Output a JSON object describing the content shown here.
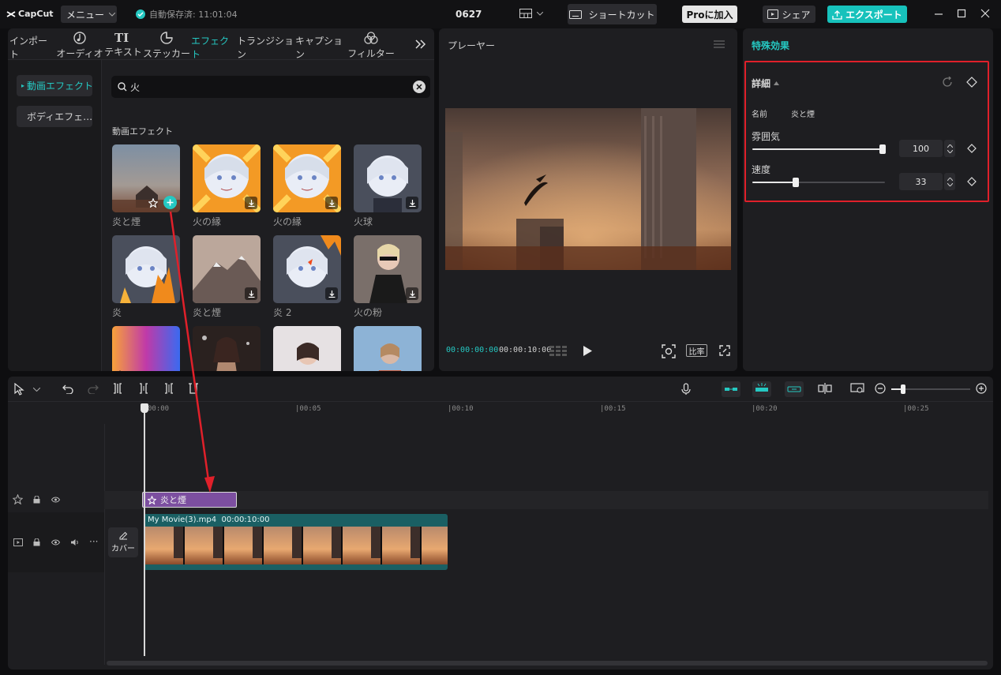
{
  "app": {
    "logo_text": "CapCut",
    "menu_label": "メニュー",
    "autosave_text": "自動保存済: 11:01:04",
    "project_name": "0627",
    "shortcut_label": "ショートカット",
    "pro_label": "Proに加入",
    "share_label": "シェア",
    "export_label": "エクスポート"
  },
  "media": {
    "tabs": [
      {
        "label": "インポート",
        "icon": "import-icon"
      },
      {
        "label": "オーディオ",
        "icon": "audio-icon"
      },
      {
        "label": "テキスト",
        "icon": "text-icon"
      },
      {
        "label": "ステッカー",
        "icon": "sticker-icon"
      },
      {
        "label": "エフェクト",
        "icon": "effects-icon",
        "active": true
      },
      {
        "label": "トランジション",
        "icon": "transition-icon"
      },
      {
        "label": "キャプション",
        "icon": "caption-icon"
      },
      {
        "label": "フィルター",
        "icon": "filter-icon"
      }
    ],
    "sidenav": [
      {
        "label": "動画エフェクト",
        "active": true
      },
      {
        "label": "ボディエフェ…"
      }
    ],
    "search_value": "火",
    "section_title": "動画エフェクト",
    "items": [
      {
        "label": "炎と煙",
        "style": "smoke-house",
        "state": "add"
      },
      {
        "label": "火の縁",
        "style": "anime-fire",
        "state": "download"
      },
      {
        "label": "火の縁",
        "style": "anime-fire",
        "state": "download"
      },
      {
        "label": "火球",
        "style": "anime-plain",
        "state": "download"
      },
      {
        "label": "炎",
        "style": "anime-flame",
        "state": "none"
      },
      {
        "label": "炎と煙",
        "style": "mountain",
        "state": "download"
      },
      {
        "label": "炎 2",
        "style": "anime-flame2",
        "state": "download"
      },
      {
        "label": "火の粉",
        "style": "woman-sunglasses",
        "state": "download"
      },
      {
        "label": "",
        "style": "concert",
        "state": "none"
      },
      {
        "label": "",
        "style": "party-woman",
        "state": "none"
      },
      {
        "label": "",
        "style": "woman-pink",
        "state": "none"
      },
      {
        "label": "",
        "style": "woman-blue",
        "state": "none"
      }
    ]
  },
  "player": {
    "title": "プレーヤー",
    "time_current": "00:00:00:00",
    "time_total": "00:00:10:00",
    "ratio_label": "比率"
  },
  "props": {
    "title": "特殊効果",
    "section": "詳細",
    "name_label": "名前",
    "name_value": "炎と煙",
    "params": [
      {
        "label": "雰囲気",
        "value": "100",
        "fraction": 1.0
      },
      {
        "label": "速度",
        "value": "33",
        "fraction": 0.33
      }
    ]
  },
  "timeline": {
    "ruler": [
      "00:00",
      "|00:05",
      "|00:10",
      "|00:15",
      "|00:20",
      "|00:25"
    ],
    "effect_clip_label": "炎と煙",
    "video_clip_name": "My Movie(3).mp4",
    "video_clip_duration": "00:00:10:00",
    "cover_label": "カバー"
  },
  "colors": {
    "accent": "#25c8c2",
    "highlight_box": "#e0202a",
    "effect_clip": "#7c4fa0",
    "video_clip": "#1a5f63"
  }
}
